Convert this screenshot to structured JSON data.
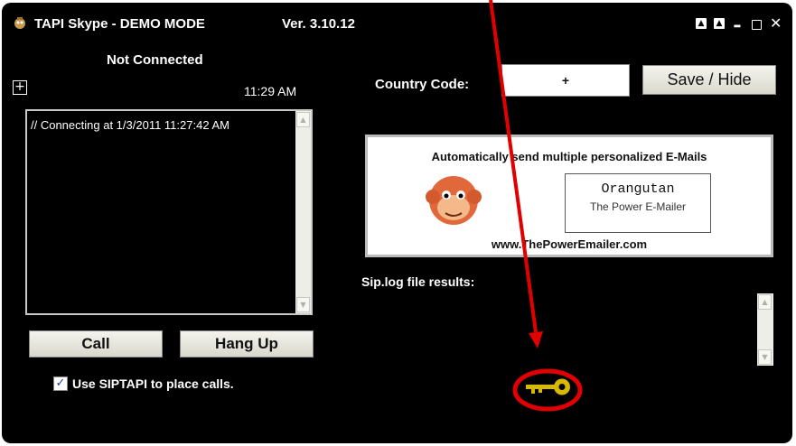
{
  "window": {
    "title": "TAPI Skype - DEMO MODE",
    "version": "Ver. 3.10.12",
    "controls": [
      "pin",
      "up",
      "minimize",
      "maximize",
      "close"
    ]
  },
  "left_panel": {
    "status": "Not Connected",
    "expand_symbol": "+",
    "time": "11:29 AM",
    "log_text": "// Connecting at 1/3/2011 11:27:42 AM",
    "call_label": "Call",
    "hangup_label": "Hang Up",
    "siptapi_checked": true,
    "siptapi_label": "Use SIPTAPI to place calls."
  },
  "right_panel": {
    "country_code_label": "Country Code:",
    "country_code_value": "+",
    "save_hide_label": "Save / Hide",
    "banner": {
      "headline": "Automatically send multiple personalized E-Mails",
      "product_name": "Orangutan",
      "product_sub": "The Power E-Mailer",
      "url": "www.ThePowerEmailer.com"
    },
    "sip_log_label": "Sip.log file results:"
  },
  "annotation": {
    "arrow_color": "#e00000",
    "circle_color": "#e00000",
    "target_icon": "key-icon"
  }
}
